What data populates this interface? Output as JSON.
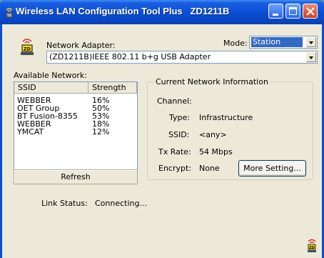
{
  "window": {
    "title": "Wireless LAN Configuration Tool Plus   ZD1211B"
  },
  "adapter": {
    "label": "Network Adapter:",
    "value": "(ZD1211B)IEEE 802.11 b+g USB Adapter"
  },
  "mode": {
    "label": "Mode:",
    "value": "Station"
  },
  "networks": {
    "label": "Available Network:",
    "columns": [
      "SSID",
      "Strength"
    ],
    "rows": [
      {
        "ssid": "WEBBER",
        "strength": "16%"
      },
      {
        "ssid": "OET Group",
        "strength": "50%"
      },
      {
        "ssid": "BT Fusion-8355",
        "strength": "53%"
      },
      {
        "ssid": "WEBBER",
        "strength": "18%"
      },
      {
        "ssid": "YMCAT",
        "strength": "12%"
      }
    ],
    "refresh_label": "Refresh"
  },
  "current": {
    "title": "Current Network Information",
    "channel_label": "Channel:",
    "channel_value": "",
    "type_label": "Type:",
    "type_value": "Infrastructure",
    "ssid_label": "SSID:",
    "ssid_value": "<any>",
    "txrate_label": "Tx Rate:",
    "txrate_value": "54 Mbps",
    "encrypt_label": "Encrypt:",
    "encrypt_value": "None",
    "more_label": "More Setting..."
  },
  "status": {
    "label": "Link Status:",
    "value": "Connecting..."
  },
  "icons": {
    "app": "wireless-adapter-icon",
    "tray": "zd-wireless-icon"
  }
}
